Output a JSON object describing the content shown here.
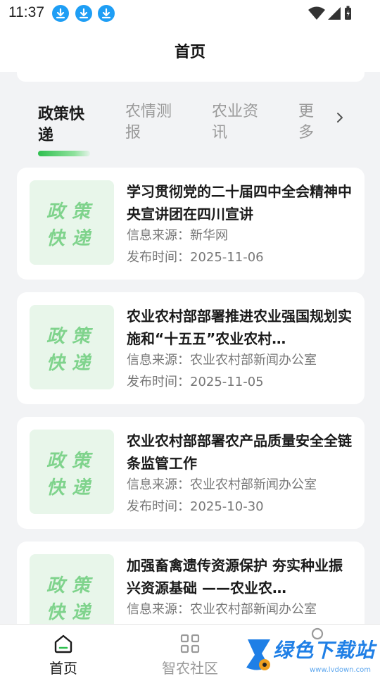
{
  "status_bar": {
    "time": "11:37",
    "notification_icons": [
      "download-icon",
      "download-icon",
      "download-icon"
    ],
    "system_icons": [
      "wifi-icon",
      "cellular-signal-icon",
      "battery-charging-icon"
    ]
  },
  "header": {
    "title": "首页"
  },
  "tabs": [
    {
      "label": "政策快递",
      "active": true
    },
    {
      "label": "农情测报",
      "active": false
    },
    {
      "label": "农业资讯",
      "active": false
    },
    {
      "label": "更多",
      "active": false
    }
  ],
  "news": [
    {
      "thumb_line1": "政策",
      "thumb_line2": "快递",
      "title": "学习贯彻党的二十届四中全会精神中央宣讲团在四川宣讲",
      "source": "信息来源：新华网",
      "date": "发布时间：2025-11-06"
    },
    {
      "thumb_line1": "政策",
      "thumb_line2": "快递",
      "title": "农业农村部部署推进农业强国规划实施和“十五五”农业农村…",
      "source": "信息来源：农业农村部新闻办公室",
      "date": "发布时间：2025-11-05"
    },
    {
      "thumb_line1": "政策",
      "thumb_line2": "快递",
      "title": "农业农村部部署农产品质量安全全链条监管工作",
      "source": "信息来源：农业农村部新闻办公室",
      "date": "发布时间：2025-10-30"
    },
    {
      "thumb_line1": "政策",
      "thumb_line2": "快递",
      "title": "加强畜禽遗传资源保护 夯实种业振兴资源基础 ——农业农…",
      "source": "信息来源：农业农村部新闻办公室",
      "date": ""
    }
  ],
  "bottom_nav": [
    {
      "label": "首页",
      "icon": "home-icon",
      "active": true
    },
    {
      "label": "智农社区",
      "icon": "grid-icon",
      "active": false
    },
    {
      "label": "",
      "icon": "profile-icon",
      "active": false
    }
  ],
  "watermark": {
    "text": "绿色下载站",
    "url": "www.lvdown.com"
  },
  "colors": {
    "accent": "#2fbf4f",
    "thumb_bg": "#e8f6ea",
    "thumb_text": "#7fd38c",
    "page_bg": "#f2f3f5"
  }
}
